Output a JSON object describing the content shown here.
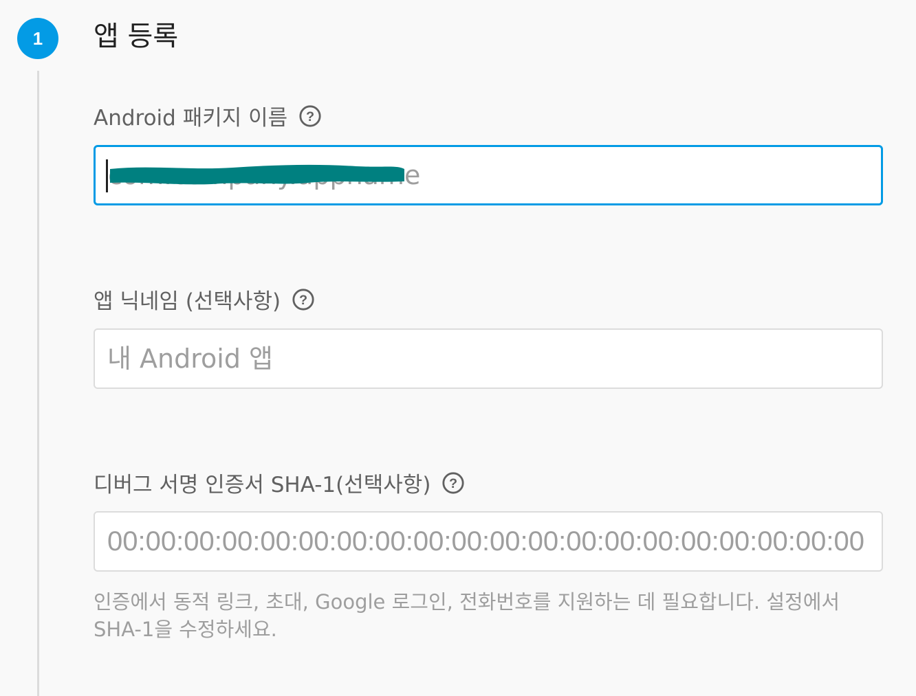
{
  "step": {
    "number": "1",
    "title": "앱 등록"
  },
  "package_field": {
    "label": "Android 패키지 이름",
    "value": "",
    "placeholder": "com.company.appname",
    "focused": true,
    "help_icon": "help-circle-icon"
  },
  "nickname_field": {
    "label": "앱 닉네임 (선택사항)",
    "value": "",
    "placeholder": "내 Android 앱",
    "help_icon": "help-circle-icon"
  },
  "sha_field": {
    "label": "디버그 서명 인증서 SHA-1(선택사항)",
    "value": "",
    "placeholder": "00:00:00:00:00:00:00:00:00:00:00:00:00:00:00:00:00:00:00:00",
    "help_icon": "help-circle-icon",
    "helper_text": "인증에서 동적 링크, 초대, Google 로그인, 전화번호를 지원하는 데 필요합니다. 설정에서 SHA-1을 수정하세요."
  },
  "colors": {
    "accent": "#039be5",
    "redaction": "#008080"
  }
}
